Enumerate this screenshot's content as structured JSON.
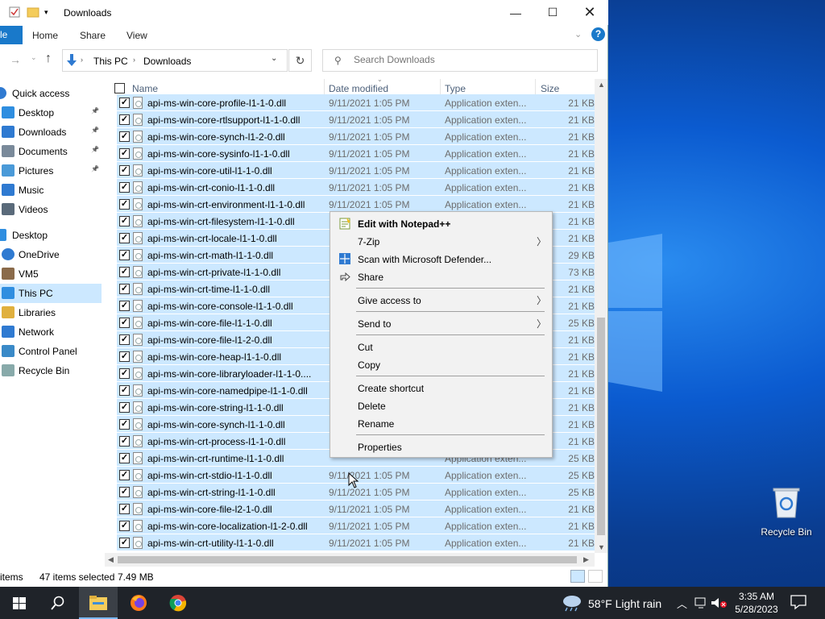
{
  "window": {
    "title": "Downloads"
  },
  "ribbon": {
    "file_tab": "le",
    "tabs": [
      "Home",
      "Share",
      "View"
    ],
    "help": "?"
  },
  "address": {
    "crumbs": [
      "This PC",
      "Downloads"
    ]
  },
  "search": {
    "placeholder": "Search Downloads"
  },
  "navpane": {
    "items": [
      {
        "label": "Quick access",
        "icon": "star-icon"
      },
      {
        "label": "Desktop",
        "icon": "desktop-icon",
        "pinned": true
      },
      {
        "label": "Downloads",
        "icon": "download-icon",
        "pinned": true
      },
      {
        "label": "Documents",
        "icon": "documents-icon",
        "pinned": true
      },
      {
        "label": "Pictures",
        "icon": "pictures-icon",
        "pinned": true
      },
      {
        "label": "Music",
        "icon": "music-icon"
      },
      {
        "label": "Videos",
        "icon": "videos-icon"
      },
      {
        "label": "Desktop",
        "icon": "desktop-icon"
      },
      {
        "label": "OneDrive",
        "icon": "cloud-icon"
      },
      {
        "label": "VM5",
        "icon": "user-icon"
      },
      {
        "label": "This PC",
        "icon": "pc-icon",
        "selected": true
      },
      {
        "label": "Libraries",
        "icon": "libraries-icon"
      },
      {
        "label": "Network",
        "icon": "network-icon"
      },
      {
        "label": "Control Panel",
        "icon": "control-panel-icon"
      },
      {
        "label": "Recycle Bin",
        "icon": "recycle-bin-icon"
      }
    ]
  },
  "columns": {
    "name": "Name",
    "date": "Date modified",
    "type": "Type",
    "size": "Size"
  },
  "files": [
    {
      "name": "api-ms-win-core-profile-l1-1-0.dll",
      "date": "9/11/2021 1:05 PM",
      "type": "Application exten...",
      "size": "21 KB"
    },
    {
      "name": "api-ms-win-core-rtlsupport-l1-1-0.dll",
      "date": "9/11/2021 1:05 PM",
      "type": "Application exten...",
      "size": "21 KB"
    },
    {
      "name": "api-ms-win-core-synch-l1-2-0.dll",
      "date": "9/11/2021 1:05 PM",
      "type": "Application exten...",
      "size": "21 KB"
    },
    {
      "name": "api-ms-win-core-sysinfo-l1-1-0.dll",
      "date": "9/11/2021 1:05 PM",
      "type": "Application exten...",
      "size": "21 KB"
    },
    {
      "name": "api-ms-win-core-util-l1-1-0.dll",
      "date": "9/11/2021 1:05 PM",
      "type": "Application exten...",
      "size": "21 KB"
    },
    {
      "name": "api-ms-win-crt-conio-l1-1-0.dll",
      "date": "9/11/2021 1:05 PM",
      "type": "Application exten...",
      "size": "21 KB"
    },
    {
      "name": "api-ms-win-crt-environment-l1-1-0.dll",
      "date": "9/11/2021 1:05 PM",
      "type": "Application exten...",
      "size": "21 KB"
    },
    {
      "name": "api-ms-win-crt-filesystem-l1-1-0.dll",
      "date": "",
      "type": "",
      "size": "21 KB"
    },
    {
      "name": "api-ms-win-crt-locale-l1-1-0.dll",
      "date": "",
      "type": "",
      "size": "21 KB"
    },
    {
      "name": "api-ms-win-crt-math-l1-1-0.dll",
      "date": "",
      "type": "",
      "size": "29 KB"
    },
    {
      "name": "api-ms-win-crt-private-l1-1-0.dll",
      "date": "",
      "type": "",
      "size": "73 KB"
    },
    {
      "name": "api-ms-win-crt-time-l1-1-0.dll",
      "date": "",
      "type": "",
      "size": "21 KB"
    },
    {
      "name": "api-ms-win-core-console-l1-1-0.dll",
      "date": "",
      "type": "",
      "size": "21 KB"
    },
    {
      "name": "api-ms-win-core-file-l1-1-0.dll",
      "date": "",
      "type": "",
      "size": "25 KB"
    },
    {
      "name": "api-ms-win-core-file-l1-2-0.dll",
      "date": "",
      "type": "",
      "size": "21 KB"
    },
    {
      "name": "api-ms-win-core-heap-l1-1-0.dll",
      "date": "",
      "type": "",
      "size": "21 KB"
    },
    {
      "name": "api-ms-win-core-libraryloader-l1-1-0....",
      "date": "",
      "type": "",
      "size": "21 KB"
    },
    {
      "name": "api-ms-win-core-namedpipe-l1-1-0.dll",
      "date": "",
      "type": "",
      "size": "21 KB"
    },
    {
      "name": "api-ms-win-core-string-l1-1-0.dll",
      "date": "",
      "type": "",
      "size": "21 KB"
    },
    {
      "name": "api-ms-win-core-synch-l1-1-0.dll",
      "date": "",
      "type": "",
      "size": "21 KB"
    },
    {
      "name": "api-ms-win-crt-process-l1-1-0.dll",
      "date": "",
      "type": "",
      "size": "21 KB"
    },
    {
      "name": "api-ms-win-crt-runtime-l1-1-0.dll",
      "date": "",
      "type": "Application exten...",
      "size": "25 KB"
    },
    {
      "name": "api-ms-win-crt-stdio-l1-1-0.dll",
      "date": "9/11/2021 1:05 PM",
      "type": "Application exten...",
      "size": "25 KB"
    },
    {
      "name": "api-ms-win-crt-string-l1-1-0.dll",
      "date": "9/11/2021 1:05 PM",
      "type": "Application exten...",
      "size": "25 KB"
    },
    {
      "name": "api-ms-win-core-file-l2-1-0.dll",
      "date": "9/11/2021 1:05 PM",
      "type": "Application exten...",
      "size": "21 KB"
    },
    {
      "name": "api-ms-win-core-localization-l1-2-0.dll",
      "date": "9/11/2021 1:05 PM",
      "type": "Application exten...",
      "size": "21 KB"
    },
    {
      "name": "api-ms-win-crt-utility-l1-1-0.dll",
      "date": "9/11/2021 1:05 PM",
      "type": "Application exten...",
      "size": "21 KB"
    }
  ],
  "status": {
    "items_label": "items",
    "selected": "47 items selected",
    "size": "7.49 MB"
  },
  "context_menu": {
    "items": [
      {
        "label": "Edit with Notepad++",
        "bold": true,
        "icon": "notepad-plus-plus-icon"
      },
      {
        "label": "7-Zip",
        "submenu": true
      },
      {
        "label": "Scan with Microsoft Defender...",
        "icon": "defender-icon"
      },
      {
        "label": "Share",
        "icon": "share-icon"
      },
      {
        "separator": true
      },
      {
        "label": "Give access to",
        "submenu": true
      },
      {
        "separator": true
      },
      {
        "label": "Send to",
        "submenu": true
      },
      {
        "separator": true
      },
      {
        "label": "Cut"
      },
      {
        "label": "Copy"
      },
      {
        "separator": true
      },
      {
        "label": "Create shortcut"
      },
      {
        "label": "Delete"
      },
      {
        "label": "Rename"
      },
      {
        "separator": true
      },
      {
        "label": "Properties"
      }
    ]
  },
  "desktop": {
    "recycle_bin_label": "Recycle Bin"
  },
  "taskbar": {
    "apps": [
      "start-icon",
      "search-icon",
      "file-explorer-icon",
      "firefox-icon",
      "chrome-icon"
    ],
    "weather": "58°F  Light rain",
    "time": "3:35 AM",
    "date": "5/28/2023"
  }
}
